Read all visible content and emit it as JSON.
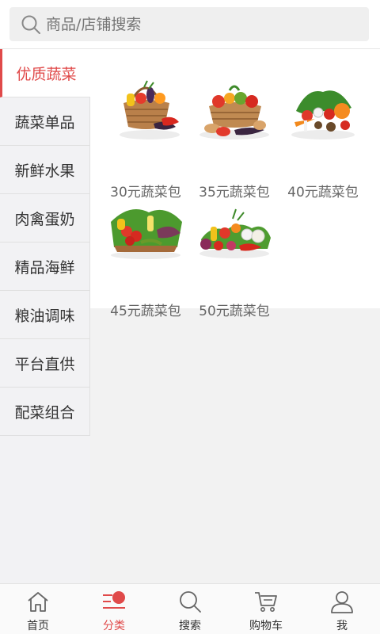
{
  "search": {
    "placeholder": "商品/店铺搜索"
  },
  "sidebar": {
    "items": [
      {
        "label": "优质蔬菜",
        "active": true
      },
      {
        "label": "蔬菜单品"
      },
      {
        "label": "新鲜水果"
      },
      {
        "label": "肉禽蛋奶"
      },
      {
        "label": "精品海鲜"
      },
      {
        "label": "粮油调味"
      },
      {
        "label": "平台直供"
      },
      {
        "label": "配菜组合"
      }
    ]
  },
  "products": [
    {
      "name": "30元蔬菜包",
      "icon": "vegetable-basket-icon"
    },
    {
      "name": "35元蔬菜包",
      "icon": "vegetable-basket-icon"
    },
    {
      "name": "40元蔬菜包",
      "icon": "vegetable-pile-icon"
    },
    {
      "name": "45元蔬菜包",
      "icon": "vegetable-crate-icon"
    },
    {
      "name": "50元蔬菜包",
      "icon": "vegetable-assortment-icon"
    }
  ],
  "tabbar": {
    "items": [
      {
        "label": "首页",
        "icon": "home-icon"
      },
      {
        "label": "分类",
        "icon": "category-icon",
        "active": true
      },
      {
        "label": "搜索",
        "icon": "search-icon"
      },
      {
        "label": "购物车",
        "icon": "cart-icon"
      },
      {
        "label": "我",
        "icon": "user-icon"
      }
    ]
  },
  "colors": {
    "accent": "#e04a4a",
    "background": "#f2f2f2",
    "sidebar": "#f2f2f4"
  }
}
